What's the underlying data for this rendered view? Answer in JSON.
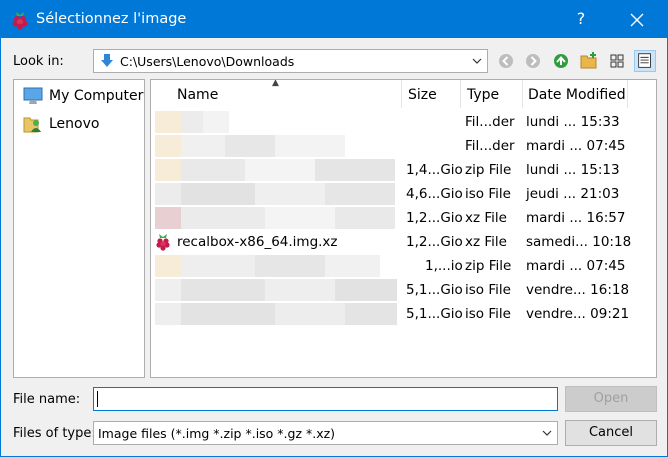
{
  "window": {
    "title": "Sélectionnez l'image",
    "help_label": "?",
    "accent_color": "#0078d7"
  },
  "lookin": {
    "label": "Look in:",
    "path": "C:\\Users\\Lenovo\\Downloads"
  },
  "toolbar": {
    "icons": [
      "back-icon",
      "forward-icon",
      "up-folder-icon",
      "new-folder-icon",
      "list-view-icon",
      "detail-view-icon"
    ]
  },
  "sidebar": {
    "items": [
      {
        "label": "My Computer",
        "icon": "computer-icon"
      },
      {
        "label": "Lenovo",
        "icon": "user-folder-icon"
      }
    ]
  },
  "filelist": {
    "columns": [
      "Name",
      "Size",
      "Type",
      "Date Modified"
    ],
    "rows": [
      {
        "name": "",
        "size": "",
        "type": "Fil...der",
        "date": "lundi ... 15:33"
      },
      {
        "name": "",
        "size": "",
        "type": "Fil...der",
        "date": "mardi ... 07:45"
      },
      {
        "name": "",
        "size": "1,4...Gio",
        "type": "zip File",
        "date": "lundi ... 15:13"
      },
      {
        "name": "",
        "size": "4,6...Gio",
        "type": "iso File",
        "date": "jeudi ... 21:03"
      },
      {
        "name": "",
        "size": "1,2...Gio",
        "type": "xz File",
        "date": "mardi ... 16:57"
      },
      {
        "name": "recalbox-x86_64.img.xz",
        "size": "1,2...Gio",
        "type": "xz File",
        "date": "samedi... 10:18"
      },
      {
        "name": "",
        "size": "1,...io",
        "type": "zip File",
        "date": "mardi ... 07:45"
      },
      {
        "name": "",
        "size": "5,1...Gio",
        "type": "iso File",
        "date": "vendre... 16:18"
      },
      {
        "name": "",
        "size": "5,1...Gio",
        "type": "iso File",
        "date": "vendre... 09:21"
      }
    ]
  },
  "filename": {
    "label": "File name:",
    "value": "",
    "open_label": "Open"
  },
  "filetype": {
    "label": "Files of type:",
    "value": "Image files (*.img *.zip *.iso *.gz *.xz)",
    "cancel_label": "Cancel"
  }
}
